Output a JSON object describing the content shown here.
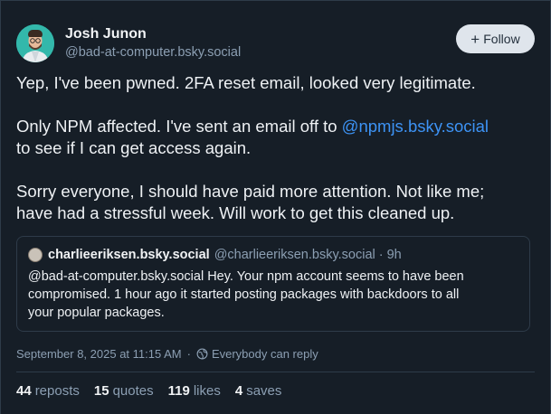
{
  "author": {
    "display_name": "Josh Junon",
    "handle": "@bad-at-computer.bsky.social",
    "avatar": "avatar-photo"
  },
  "follow_button": {
    "label": "Follow",
    "icon": "plus-icon"
  },
  "post": {
    "paragraph1": "Yep, I've been pwned. 2FA reset email, looked very legitimate.",
    "paragraph2_before": "Only NPM affected. I've sent an email off to ",
    "paragraph2_mention": "@npmjs.bsky.social",
    "paragraph2_line2": "to see if I can get access again.",
    "paragraph3_line1": "Sorry everyone, I should have paid more attention. Not like me;",
    "paragraph3_line2": "have had a stressful week. Will work to get this cleaned up."
  },
  "quote": {
    "display_name": "charlieeriksen.bsky.social",
    "handle": "@charlieeriksen.bsky.social",
    "time": "· 9h",
    "body_line1": "@bad-at-computer.bsky.social Hey. Your npm account seems to have been",
    "body_line2": "compromised. 1 hour ago it started posting packages with backdoors to all",
    "body_line3": "your popular packages."
  },
  "meta": {
    "timestamp": "September 8, 2025 at 11:15 AM",
    "reply_setting": "Everybody can reply",
    "reply_icon": "globe-icon"
  },
  "stats": {
    "reposts_count": "44",
    "reposts_label": "reposts",
    "quotes_count": "15",
    "quotes_label": "quotes",
    "likes_count": "119",
    "likes_label": "likes",
    "saves_count": "4",
    "saves_label": "saves"
  },
  "colors": {
    "background": "#161e27",
    "link": "#3d93f5",
    "muted": "#8c9fb3",
    "border": "#2e3b49"
  }
}
